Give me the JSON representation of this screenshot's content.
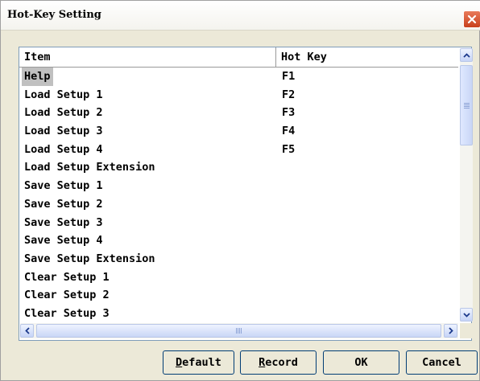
{
  "window": {
    "title": "Hot-Key Setting"
  },
  "list": {
    "columns": [
      "Item",
      "Hot Key"
    ],
    "rows": [
      {
        "item": "Help",
        "hotkey": "F1"
      },
      {
        "item": "Load Setup 1",
        "hotkey": "F2"
      },
      {
        "item": "Load Setup 2",
        "hotkey": "F3"
      },
      {
        "item": "Load Setup 3",
        "hotkey": "F4"
      },
      {
        "item": "Load Setup 4",
        "hotkey": "F5"
      },
      {
        "item": "Load Setup Extension",
        "hotkey": ""
      },
      {
        "item": "Save Setup 1",
        "hotkey": ""
      },
      {
        "item": "Save Setup 2",
        "hotkey": ""
      },
      {
        "item": "Save Setup 3",
        "hotkey": ""
      },
      {
        "item": "Save Setup 4",
        "hotkey": ""
      },
      {
        "item": "Save Setup Extension",
        "hotkey": ""
      },
      {
        "item": "Clear Setup 1",
        "hotkey": ""
      },
      {
        "item": "Clear Setup 2",
        "hotkey": ""
      },
      {
        "item": "Clear Setup 3",
        "hotkey": ""
      }
    ],
    "selected_index": 0
  },
  "buttons": {
    "default": {
      "mnemonic": "D",
      "rest": "efault"
    },
    "record": {
      "mnemonic": "R",
      "rest": "ecord"
    },
    "ok": "OK",
    "cancel": "Cancel"
  },
  "colors": {
    "selection": "#c0c0c0",
    "close_button": "#d4532f",
    "dialog_face": "#ece9d8"
  },
  "icons": {
    "close": "close-icon",
    "scroll_up": "arrow-up-icon",
    "scroll_down": "arrow-down-icon",
    "scroll_left": "arrow-left-icon",
    "scroll_right": "arrow-right-icon"
  }
}
